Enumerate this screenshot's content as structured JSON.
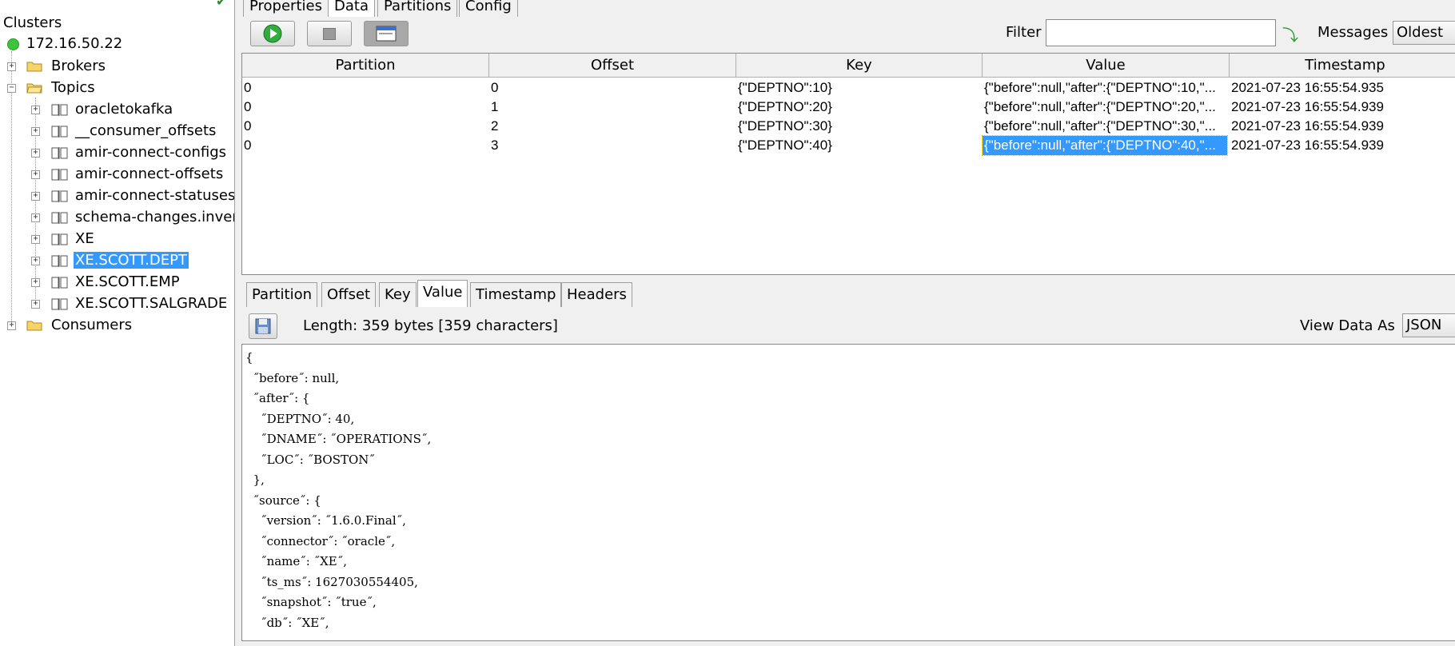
{
  "tree": {
    "title": "Clusters",
    "cluster": "172.16.50.22",
    "brokers": "Brokers",
    "topics": "Topics",
    "topic_items": [
      "oracletokafka",
      "__consumer_offsets",
      "amir-connect-configs",
      "amir-connect-offsets",
      "amir-connect-statuses",
      "schema-changes.invent",
      "XE",
      "XE.SCOTT.DEPT",
      "XE.SCOTT.EMP",
      "XE.SCOTT.SALGRADE"
    ],
    "selected_topic": "XE.SCOTT.DEPT",
    "consumers": "Consumers"
  },
  "top_tabs": [
    "Properties",
    "Data",
    "Partitions",
    "Config"
  ],
  "toolbar": {
    "filter_label": "Filter",
    "filter_value": "",
    "messages_label": "Messages",
    "messages_value": "Oldest"
  },
  "grid": {
    "columns": [
      "Partition",
      "Offset",
      "Key",
      "Value",
      "Timestamp"
    ],
    "rows": [
      {
        "partition": "0",
        "offset": "0",
        "key": "{\"DEPTNO\":10}",
        "value": "{\"before\":null,\"after\":{\"DEPTNO\":10,\"...",
        "timestamp": "2021-07-23 16:55:54.935"
      },
      {
        "partition": "0",
        "offset": "1",
        "key": "{\"DEPTNO\":20}",
        "value": "{\"before\":null,\"after\":{\"DEPTNO\":20,\"...",
        "timestamp": "2021-07-23 16:55:54.939"
      },
      {
        "partition": "0",
        "offset": "2",
        "key": "{\"DEPTNO\":30}",
        "value": "{\"before\":null,\"after\":{\"DEPTNO\":30,\"...",
        "timestamp": "2021-07-23 16:55:54.939"
      },
      {
        "partition": "0",
        "offset": "3",
        "key": "{\"DEPTNO\":40}",
        "value": "{\"before\":null,\"after\":{\"DEPTNO\":40,\"...",
        "timestamp": "2021-07-23 16:55:54.939"
      }
    ]
  },
  "detail_tabs": [
    "Partition",
    "Offset",
    "Key",
    "Value",
    "Timestamp",
    "Headers"
  ],
  "detail": {
    "length_text": "Length: 359 bytes [359 characters]",
    "view_as_label": "View Data As",
    "view_as_value": "JSON",
    "json_lines": [
      "{",
      "  ˝before˝: null,",
      "  ˝after˝: {",
      "    ˝DEPTNO˝: 40,",
      "    ˝DNAME˝: ˝OPERATIONS˝,",
      "    ˝LOC˝: ˝BOSTON˝",
      "  },",
      "  ˝source˝: {",
      "    ˝version˝: ˝1.6.0.Final˝,",
      "    ˝connector˝: ˝oracle˝,",
      "    ˝name˝: ˝XE˝,",
      "    ˝ts_ms˝: 1627030554405,",
      "    ˝snapshot˝: ˝true˝,",
      "    ˝db˝: ˝XE˝,"
    ]
  }
}
